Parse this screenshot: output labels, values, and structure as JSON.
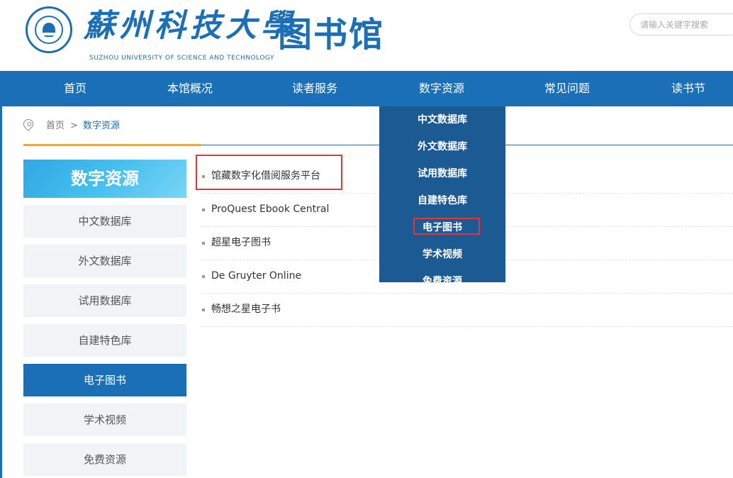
{
  "header": {
    "school_name_cn": "蘇州科技大學",
    "school_name_en": "SUZHOU UNIVERSITY OF SCIENCE AND TECHNOLOGY",
    "library_title": "图书馆",
    "search_placeholder": "请输入关键字搜索",
    "logo_icon": "university-seal-icon"
  },
  "nav": {
    "items": [
      "首页",
      "本馆概况",
      "读者服务",
      "数字资源",
      "常见问题",
      "读书节"
    ]
  },
  "dropdown": {
    "items": [
      "中文数据库",
      "外文数据库",
      "试用数据库",
      "自建特色库",
      "电子图书",
      "学术视频",
      "免费资源"
    ],
    "highlighted": "电子图书"
  },
  "breadcrumb": {
    "home": "首页",
    "separator": ">",
    "current": "数字资源",
    "icon": "location-pin-icon"
  },
  "sidebar": {
    "title": "数字资源",
    "items": [
      "中文数据库",
      "外文数据库",
      "试用数据库",
      "自建特色库",
      "电子图书",
      "学术视频",
      "免费资源"
    ],
    "active": "电子图书"
  },
  "content": {
    "items": [
      "馆藏数字化借阅服务平台",
      "ProQuest Ebook Central",
      "超星电子图书",
      "De Gruyter Online",
      "畅想之星电子书"
    ],
    "highlighted": "馆藏数字化借阅服务平台"
  },
  "colors": {
    "primary": "#1b6fb6",
    "dropdown_bg": "#1b5a93",
    "accent_line": "#f0a638",
    "highlight_border": "#e0353b",
    "sidebar_bg": "#f2f3f7"
  }
}
